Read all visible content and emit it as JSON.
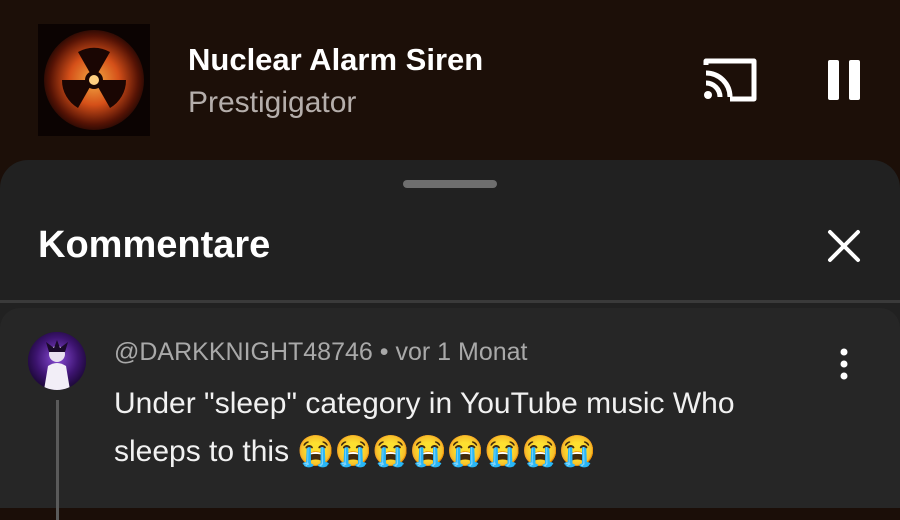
{
  "player": {
    "title": "Nuclear Alarm Siren",
    "artist": "Prestigigator",
    "cast_icon": "cast-icon",
    "pause_icon": "pause-icon"
  },
  "comments_sheet": {
    "title": "Kommentare",
    "close_icon": "close-icon",
    "comments": [
      {
        "author": "@DARKKNIGHT48746",
        "separator": " • ",
        "time": "vor 1 Monat",
        "text": "Under \"sleep\" category in YouTube music Who sleeps to this 😭😭😭😭😭😭😭😭",
        "more_icon": "more-vert-icon"
      }
    ]
  },
  "colors": {
    "player_bg": "#1c0f08",
    "sheet_bg": "#212121",
    "comment_bg": "#262626",
    "secondary_text": "#a9a9a9"
  }
}
